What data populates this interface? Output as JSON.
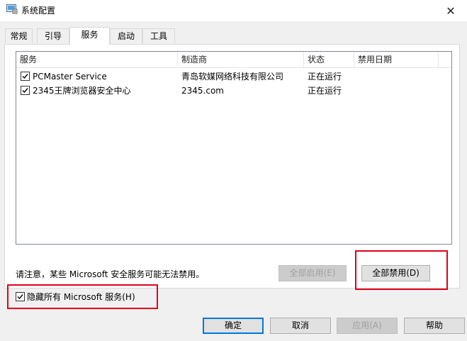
{
  "window": {
    "title": "系统配置",
    "close_glyph": "✕",
    "app_icon": "msconfig-icon"
  },
  "tabs": [
    "常规",
    "引导",
    "服务",
    "启动",
    "工具"
  ],
  "active_tab": "服务",
  "services_table": {
    "columns": [
      "服务",
      "制造商",
      "状态",
      "禁用日期"
    ],
    "rows": [
      {
        "checked": true,
        "service": "PCMaster Service",
        "manufacturer": "青岛软媒网络科技有限公司",
        "status": "正在运行",
        "disabled_date": ""
      },
      {
        "checked": true,
        "service": "2345王牌浏览器安全中心",
        "manufacturer": "2345.com",
        "status": "正在运行",
        "disabled_date": ""
      }
    ]
  },
  "note": "请注意，某些 Microsoft 安全服务可能无法禁用。",
  "buttons": {
    "enable_all": "全部启用(E)",
    "disable_all": "全部禁用(D)",
    "ok": "确定",
    "cancel": "取消",
    "apply": "应用(A)",
    "help": "帮助"
  },
  "hide_ms": {
    "label": "隐藏所有 Microsoft 服务(H)",
    "checked": true
  },
  "colors": {
    "highlight_box": "#e0001b",
    "default_button_border": "#0078d7"
  }
}
